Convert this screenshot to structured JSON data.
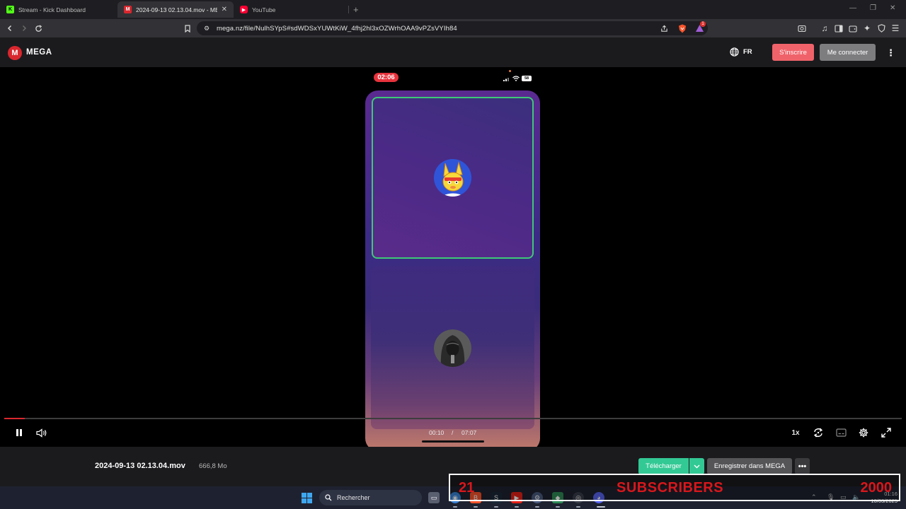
{
  "browser": {
    "tabs": [
      {
        "title": "Stream - Kick Dashboard",
        "icon": "kick-icon",
        "active": false
      },
      {
        "title": "2024-09-13 02.13.04.mov - MEG",
        "icon": "mega-icon",
        "active": true
      },
      {
        "title": "YouTube",
        "icon": "youtube-icon",
        "active": false
      }
    ],
    "url": "mega.nz/file/NulhSYpS#sdWDSxYUWtKiW_4fhj2hl3xOZWrhOAA9vPZsVYIh84",
    "notification_count": "1"
  },
  "mega_header": {
    "logo_letter": "M",
    "logo_text": "MEGA",
    "language": "FR",
    "signup_label": "S'inscrire",
    "login_label": "Me connecter"
  },
  "video": {
    "phone_clock": "02:06",
    "battery_level": "58",
    "current_time": "00:10",
    "separator": "/",
    "duration": "07:07",
    "progress_fraction": 0.023,
    "speed_label": "1x"
  },
  "file": {
    "name": "2024-09-13 02.13.04.mov",
    "size": "666,8 Mo"
  },
  "actions": {
    "download_label": "Télécharger",
    "save_label": "Enregistrer dans MEGA"
  },
  "overlay": {
    "count": "21",
    "label": "SUBSCRIBERS",
    "goal": "2000"
  },
  "taskbar": {
    "search_placeholder": "Rechercher",
    "time": "01:16",
    "date": "10/03/2025"
  },
  "colors": {
    "mega_red": "#d9272e",
    "signup": "#f0626a",
    "download": "#33c995",
    "active_border": "#3fc878",
    "overlay_text": "#d8171c"
  }
}
